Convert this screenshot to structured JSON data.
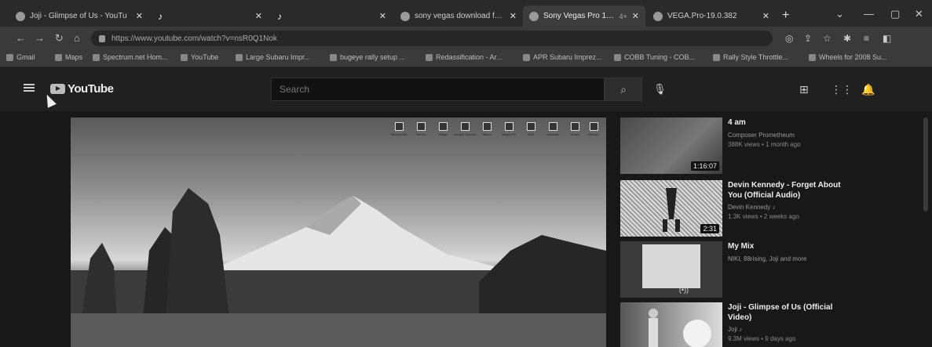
{
  "tabs": [
    {
      "label": "Joji - Glimpse of Us - YouTu",
      "icon": "tiktok-icon"
    },
    {
      "label": "",
      "icon": "tiktok-icon"
    },
    {
      "label": "",
      "icon": "tiktok-icon"
    },
    {
      "label": "sony vegas download free",
      "icon": "google-icon"
    },
    {
      "label": "Sony Vegas Pro 19 Cra",
      "icon": "page-icon"
    },
    {
      "label": "VEGA.Pro-19.0.382",
      "icon": "page-icon"
    }
  ],
  "tab_counter": "4+",
  "address_bar": {
    "url": "https://www.youtube.com/watch?v=nsR0Q1Nok"
  },
  "bookmarks": [
    "Gmail",
    "Maps",
    "Spectrum.net Hom...",
    "YouTube",
    "Large Subaru Impr...",
    "bugeye rally setup ...",
    "Redassification - Ar...",
    "APR Subaru Imprez...",
    "COBB Tuning - COB...",
    "Rally Style Throttle...",
    "Wheels for 2008 Su..."
  ],
  "youtube": {
    "logo_text": "YouTube",
    "search_placeholder": "Search"
  },
  "player": {
    "desktop_icons": [
      "Recycle Bin",
      "Firefox",
      "Vegas",
      "Google Chrome",
      "Steam",
      "Vegas Pro",
      "OBS",
      "Audacity",
      "iTunes",
      "Discord",
      "Steam"
    ]
  },
  "up_next": [
    {
      "title": "4 am",
      "channel": "Composer Prometheum",
      "meta": "388K views • 1 month ago",
      "duration": "1:16:07"
    },
    {
      "title": "Devin Kennedy - Forget About You (Official Audio)",
      "channel": "Devin Kennedy ♪",
      "meta": "1.3K views • 2 weeks ago",
      "duration": "2:31"
    },
    {
      "title": "My Mix",
      "channel": "NIKI, 88rising, Joji and more",
      "meta": "",
      "duration": "(•))"
    },
    {
      "title": "Joji - Glimpse of Us (Official Video)",
      "channel": "Joji ♪",
      "meta": "9.3M views • 9 days ago",
      "duration": ""
    }
  ],
  "colors": {
    "chrome_dark": "#2a2a2a",
    "yt_bg": "#181818",
    "yt_header": "#202020"
  }
}
